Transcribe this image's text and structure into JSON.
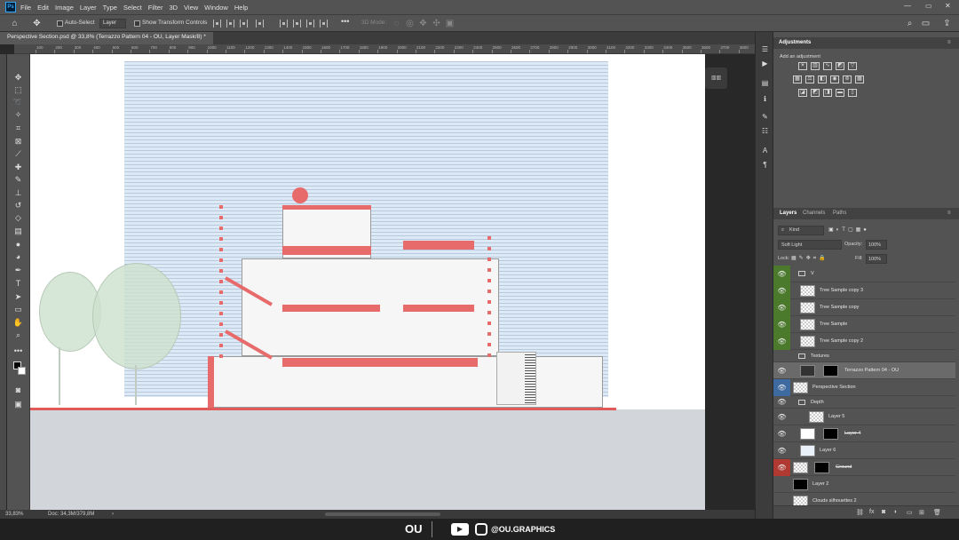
{
  "menu": [
    "File",
    "Edit",
    "Image",
    "Layer",
    "Type",
    "Select",
    "Filter",
    "3D",
    "View",
    "Window",
    "Help"
  ],
  "options": {
    "auto_select": "Auto-Select",
    "layer_select": "Layer",
    "show_transform": "Show Transform Controls",
    "mode_3d": "3D Mode:"
  },
  "document": {
    "tab_title": "Perspective Section.psd @ 33,8% (Terrazzo Pattern 04 - OU, Layer Mask/8) *"
  },
  "ruler_labels": [
    "100",
    "200",
    "300",
    "400",
    "500",
    "600",
    "700",
    "800",
    "900",
    "1000",
    "1100",
    "1200",
    "1300",
    "1400",
    "1500",
    "1600",
    "1700",
    "1800",
    "1900",
    "2000",
    "2100",
    "2200",
    "2300",
    "2400",
    "2500",
    "2600",
    "2700",
    "2800",
    "2900",
    "3000",
    "3100",
    "3200",
    "3300",
    "3400",
    "3500",
    "3600",
    "3700",
    "3800",
    "3900"
  ],
  "status": {
    "zoom": "33,83%",
    "doc": "Doc: 34,3M/379,8M"
  },
  "adjustments": {
    "title": "Adjustments",
    "subtitle": "Add an adjustment"
  },
  "layers_panel": {
    "tabs": [
      "Layers",
      "Channels",
      "Paths"
    ],
    "kind": "Kind",
    "blend_mode": "Soft Light",
    "opacity_label": "Opacity:",
    "opacity_value": "100%",
    "lock_label": "Lock:",
    "fill_label": "Fill:",
    "fill_value": "100%",
    "layers": [
      {
        "name": "V",
        "type": "group",
        "eye": "green"
      },
      {
        "name": "Tree Sample copy 3",
        "type": "layer",
        "eye": "green"
      },
      {
        "name": "Tree Sample copy",
        "type": "layer",
        "eye": "green"
      },
      {
        "name": "Tree Sample",
        "type": "layer",
        "eye": "green"
      },
      {
        "name": "Tree Sample copy 2",
        "type": "layer",
        "eye": "green"
      },
      {
        "name": "Textures",
        "type": "group",
        "eye": "none"
      },
      {
        "name": "Terrazzo Pattern 04 - OU",
        "type": "masked",
        "eye": "none"
      },
      {
        "name": "Perspective Section",
        "type": "layer",
        "eye": "blue"
      },
      {
        "name": "Depth",
        "type": "group",
        "eye": "none"
      },
      {
        "name": "Layer 5",
        "type": "layer",
        "eye": "none"
      },
      {
        "name": "Layer 4",
        "type": "masked",
        "eye": "none"
      },
      {
        "name": "Layer 6",
        "type": "layer",
        "eye": "none"
      },
      {
        "name": "Ground",
        "type": "masked",
        "eye": "red"
      },
      {
        "name": "Layer 2",
        "type": "layer",
        "eye": "none"
      },
      {
        "name": "Clouds silhouettes 2",
        "type": "layer",
        "eye": "none"
      }
    ]
  },
  "brand": {
    "logo": "OU",
    "handle": "@OU.GRAPHICS"
  }
}
